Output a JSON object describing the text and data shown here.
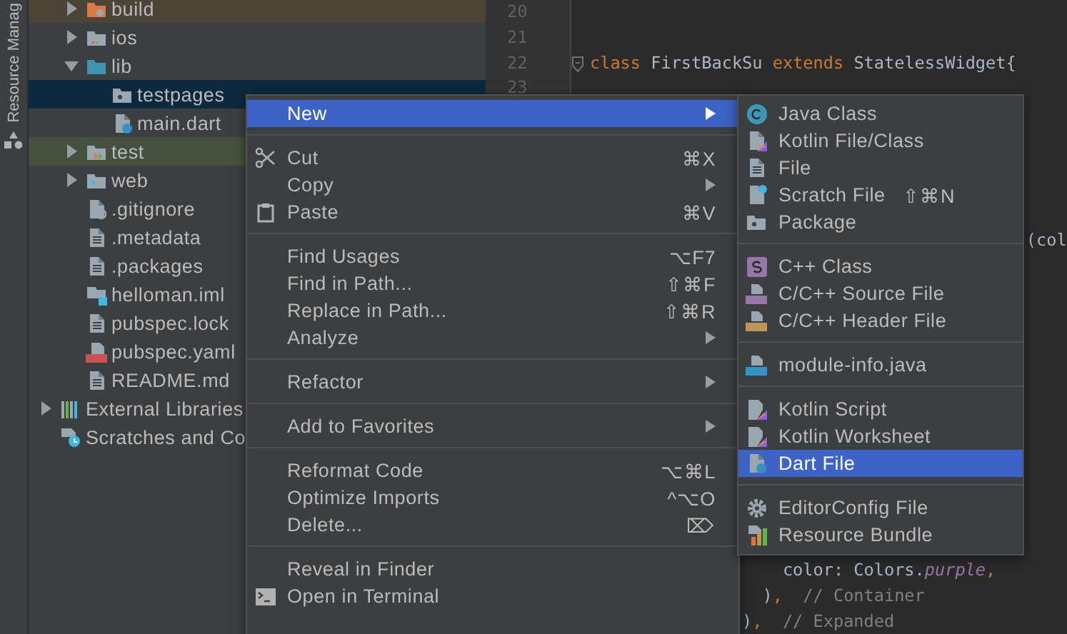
{
  "tool_strip": {
    "label": "Resource Manag"
  },
  "project_tree": {
    "items": [
      {
        "children": [
          {
            "label": "build",
            "kind": "build-folder",
            "expanded": false,
            "selected": false,
            "color": "#4b4437"
          },
          {
            "label": "ios",
            "kind": "ios-folder",
            "expanded": false,
            "selected": false
          },
          {
            "label": "lib",
            "kind": "source-folder",
            "expanded": true,
            "selected": false,
            "children": [
              {
                "label": "testpages",
                "kind": "package",
                "selected": true
              },
              {
                "label": "main.dart",
                "kind": "dart",
                "selected": false
              }
            ]
          },
          {
            "label": "test",
            "kind": "test-folder",
            "expanded": false,
            "selected": false,
            "color": "#45513f"
          },
          {
            "label": "web",
            "kind": "web-folder",
            "expanded": false,
            "selected": false
          },
          {
            "label": ".gitignore",
            "kind": "ignore",
            "selected": false
          },
          {
            "label": ".metadata",
            "kind": "text",
            "selected": false
          },
          {
            "label": ".packages",
            "kind": "text",
            "selected": false
          },
          {
            "label": "helloman.iml",
            "kind": "module",
            "selected": false
          },
          {
            "label": "pubspec.lock",
            "kind": "text",
            "selected": false
          },
          {
            "label": "pubspec.yaml",
            "kind": "yaml",
            "selected": false
          },
          {
            "label": "README.md",
            "kind": "text",
            "selected": false
          }
        ]
      },
      {
        "label": "External Libraries",
        "kind": "libraries",
        "expanded": false,
        "selected": false
      },
      {
        "label": "Scratches and Co",
        "kind": "scratches",
        "selected": false
      }
    ]
  },
  "editor": {
    "blocks": [
      {
        "lines": [
          {
            "number": "20"
          },
          {
            "number": "21"
          },
          {
            "number": "22",
            "fold": true,
            "tokens": [
              {
                "kind": "keyword",
                "text": "class "
              },
              {
                "kind": "plain",
                "text": "FirstBackSu "
              },
              {
                "kind": "keyword",
                "text": "extends "
              },
              {
                "kind": "plain",
                "text": "StatelessWidget{"
              }
            ]
          },
          {
            "number": "23"
          }
        ]
      },
      {
        "lines": [
          {
            "tokens": [
              {
                "kind": "plain",
                "text": "                                           (col"
              }
            ]
          }
        ]
      },
      {
        "lines": [
          {
            "tokens": [
              {
                "kind": "plain",
                "text": "                   color: Colors."
              },
              {
                "kind": "field",
                "text": "purple"
              },
              {
                "kind": "keyword",
                "text": ","
              }
            ]
          },
          {
            "tokens": [
              {
                "kind": "plain",
                "text": "                 )"
              },
              {
                "kind": "keyword",
                "text": ","
              },
              {
                "kind": "comment",
                "text": "  // Container"
              }
            ]
          },
          {
            "tokens": [
              {
                "kind": "plain",
                "text": "               )"
              },
              {
                "kind": "keyword",
                "text": ","
              },
              {
                "kind": "comment",
                "text": "  // Expanded"
              }
            ]
          }
        ]
      }
    ]
  },
  "context_menu": {
    "sections": [
      {
        "items": [
          {
            "label": "New",
            "submenu": true,
            "selected": true
          }
        ]
      },
      {
        "items": [
          {
            "label": "Cut",
            "kind": "scissors",
            "shortcut": "⌘X",
            "submenu": false,
            "selected": false
          },
          {
            "label": "Copy",
            "submenu": true,
            "selected": false
          },
          {
            "label": "Paste",
            "kind": "clipboard",
            "shortcut": "⌘V",
            "submenu": false,
            "selected": false
          }
        ]
      },
      {
        "items": [
          {
            "label": "Find Usages",
            "shortcut": "⌥F7",
            "submenu": false,
            "selected": false
          },
          {
            "label": "Find in Path...",
            "shortcut": "⇧⌘F",
            "submenu": false,
            "selected": false
          },
          {
            "label": "Replace in Path...",
            "shortcut": "⇧⌘R",
            "submenu": false,
            "selected": false
          },
          {
            "label": "Analyze",
            "submenu": true,
            "selected": false
          }
        ]
      },
      {
        "items": [
          {
            "label": "Refactor",
            "submenu": true,
            "selected": false
          }
        ]
      },
      {
        "items": [
          {
            "label": "Add to Favorites",
            "submenu": true,
            "selected": false
          }
        ]
      },
      {
        "items": [
          {
            "label": "Reformat Code",
            "shortcut": "⌥⌘L",
            "submenu": false,
            "selected": false
          },
          {
            "label": "Optimize Imports",
            "shortcut": "^⌥O",
            "submenu": false,
            "selected": false
          },
          {
            "label": "Delete...",
            "shortcut": "⌦",
            "submenu": false,
            "selected": false
          }
        ]
      },
      {
        "items": [
          {
            "label": "Reveal in Finder",
            "submenu": false,
            "selected": false
          },
          {
            "label": "Open in Terminal",
            "kind": "terminal",
            "submenu": false,
            "selected": false
          }
        ]
      }
    ]
  },
  "new_submenu": {
    "sections": [
      {
        "items": [
          {
            "label": "Java Class",
            "kind": "java-class",
            "selected": false
          },
          {
            "label": "Kotlin File/Class",
            "kind": "kotlin",
            "selected": false
          },
          {
            "label": "File",
            "kind": "text",
            "selected": false
          },
          {
            "label": "Scratch File",
            "kind": "scratch",
            "shortcut": "⇧⌘N",
            "selected": false
          },
          {
            "label": "Package",
            "kind": "package",
            "selected": false
          }
        ]
      },
      {
        "items": [
          {
            "label": "C++ Class",
            "kind": "cpp-class",
            "selected": false
          },
          {
            "label": "C/C++ Source File",
            "kind": "cpp-source",
            "selected": false
          },
          {
            "label": "C/C++ Header File",
            "kind": "cpp-header",
            "selected": false
          }
        ]
      },
      {
        "items": [
          {
            "label": "module-info.java",
            "kind": "java-file",
            "selected": false
          }
        ]
      },
      {
        "items": [
          {
            "label": "Kotlin Script",
            "kind": "kotlin-script",
            "selected": false
          },
          {
            "label": "Kotlin Worksheet",
            "kind": "kotlin-script",
            "selected": false
          },
          {
            "label": "Dart File",
            "kind": "dart",
            "selected": true
          }
        ]
      },
      {
        "items": [
          {
            "label": "EditorConfig File",
            "kind": "gear",
            "selected": false
          },
          {
            "label": "Resource Bundle",
            "kind": "bundle",
            "selected": false
          }
        ]
      }
    ]
  }
}
